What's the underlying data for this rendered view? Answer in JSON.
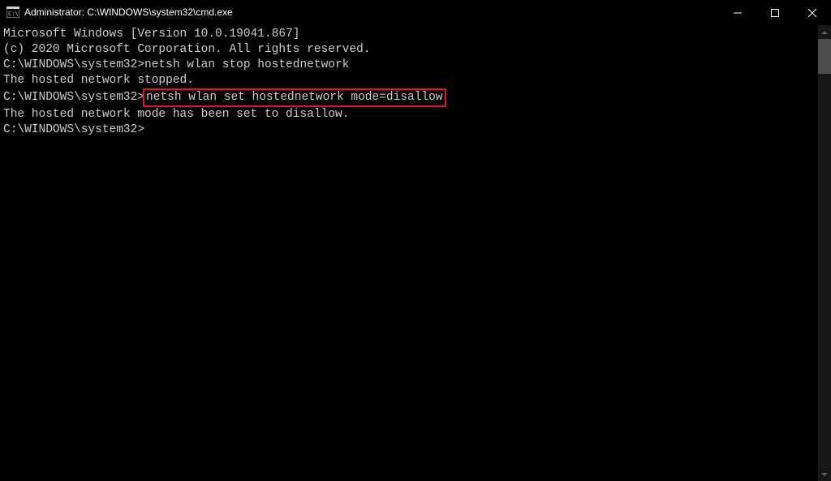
{
  "window": {
    "title": "Administrator: C:\\WINDOWS\\system32\\cmd.exe"
  },
  "terminal": {
    "line1": "Microsoft Windows [Version 10.0.19041.867]",
    "line2": "(c) 2020 Microsoft Corporation. All rights reserved.",
    "blank1": "",
    "prompt1": "C:\\WINDOWS\\system32>",
    "cmd1": "netsh wlan stop hostednetwork",
    "output1": "The hosted network stopped.",
    "blank2": "",
    "blank3": "",
    "prompt2": "C:\\WINDOWS\\system32>",
    "cmd2": "netsh wlan set hostednetwork mode=disallow",
    "output2": "The hosted network mode has been set to disallow.",
    "blank4": "",
    "blank5": "",
    "prompt3": "C:\\WINDOWS\\system32>"
  }
}
